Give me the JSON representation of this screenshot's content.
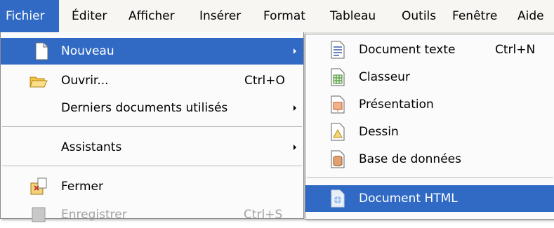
{
  "menubar": {
    "items": [
      {
        "label": "Fichier"
      },
      {
        "label": "Éditer"
      },
      {
        "label": "Afficher"
      },
      {
        "label": "Insérer"
      },
      {
        "label": "Format"
      },
      {
        "label": "Tableau"
      },
      {
        "label": "Outils"
      },
      {
        "label": "Fenêtre"
      },
      {
        "label": "Aide"
      }
    ]
  },
  "fichier_menu": {
    "items": [
      {
        "label": "Nouveau",
        "icon": "new-document-icon",
        "has_submenu": true,
        "state": "highlighted"
      },
      {
        "label": "Ouvrir...",
        "shortcut": "Ctrl+O",
        "icon": "open-folder-icon"
      },
      {
        "label": "Derniers documents utilisés",
        "has_submenu": true
      },
      {
        "label": "Assistants",
        "has_submenu": true
      },
      {
        "label": "Fermer",
        "icon": "close-document-icon"
      },
      {
        "label": "Enregistrer",
        "shortcut": "Ctrl+S",
        "icon": "save-icon",
        "state": "disabled"
      }
    ]
  },
  "nouveau_menu": {
    "items": [
      {
        "label": "Document texte",
        "shortcut": "Ctrl+N",
        "icon": "text-document-icon"
      },
      {
        "label": "Classeur",
        "icon": "spreadsheet-icon"
      },
      {
        "label": "Présentation",
        "icon": "presentation-icon"
      },
      {
        "label": "Dessin",
        "icon": "drawing-icon"
      },
      {
        "label": "Base de données",
        "icon": "database-icon"
      },
      {
        "label": "Document HTML",
        "icon": "html-document-icon",
        "state": "highlighted"
      }
    ]
  },
  "colors": {
    "highlight": "#316ac5",
    "menu_bg": "#fbfbfb",
    "menubar_bg": "#f7f6f2",
    "disabled_text": "#a3a3a3"
  }
}
